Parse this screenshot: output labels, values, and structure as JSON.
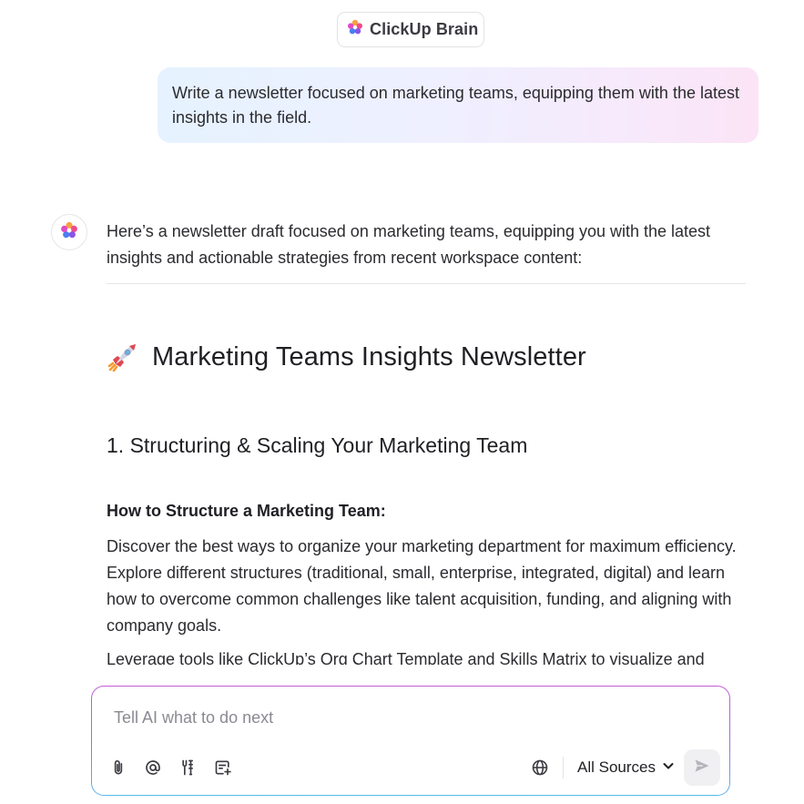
{
  "header": {
    "badge_label": "ClickUp Brain",
    "logo_icon": "clickup-brain-logo-icon"
  },
  "user_message": {
    "text": "Write a newsletter focused on marketing teams, equipping them with the latest insights in the field."
  },
  "assistant": {
    "avatar_icon": "clickup-brain-logo-icon",
    "intro": "Here’s a newsletter draft focused on marketing teams, equipping you with the latest insights and actionable strategies from recent workspace content:",
    "newsletter_emoji_icon": "rocket-icon",
    "newsletter_title": "Marketing Teams Insights Newsletter",
    "section_title": "1. Structuring & Scaling Your Marketing Team",
    "sub_heading": "How to Structure a Marketing Team:",
    "paragraph_1": "Discover the best ways to organize your marketing department for maximum efficiency. Explore different structures (traditional, small, enterprise, integrated, digital) and learn how to overcome common challenges like talent acquisition, funding, and aligning with company goals.",
    "paragraph_2": "Leverage tools like ClickUp’s Org Chart Template and Skills Matrix to visualize and"
  },
  "composer": {
    "placeholder": "Tell AI what to do next",
    "tools": [
      "paperclip-icon",
      "at-mention-icon",
      "tools-icon",
      "template-icon"
    ],
    "globe_icon": "globe-icon",
    "sources_label": "All Sources",
    "send_icon": "send-icon"
  },
  "colors": {
    "accent_purple": "#c35cd6",
    "accent_blue": "#5ab8e8",
    "bubble_left": "#e6f2ff",
    "bubble_right": "#fbe4f6"
  }
}
